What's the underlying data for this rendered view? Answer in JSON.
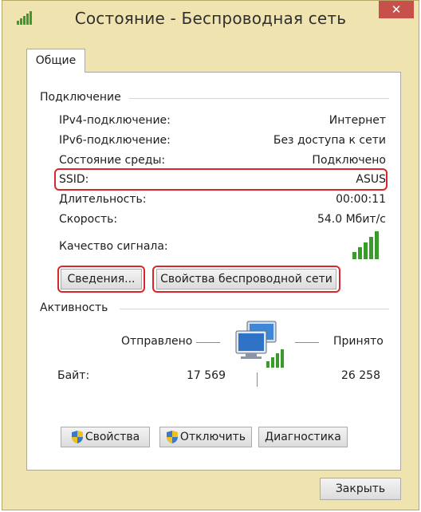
{
  "window": {
    "title": "Состояние - Беспроводная сеть",
    "close_label": "✕"
  },
  "tabs": [
    {
      "label": "Общие",
      "active": true
    }
  ],
  "connection": {
    "group_title": "Подключение",
    "rows": [
      {
        "label": "IPv4-подключение:",
        "value": "Интернет"
      },
      {
        "label": "IPv6-подключение:",
        "value": "Без доступа к сети"
      },
      {
        "label": "Состояние среды:",
        "value": "Подключено"
      },
      {
        "label": "SSID:",
        "value": "ASUS"
      },
      {
        "label": "Длительность:",
        "value": "00:00:11"
      },
      {
        "label": "Скорость:",
        "value": "54.0 Мбит/с"
      }
    ],
    "signal_label": "Качество сигнала:",
    "signal_bars": 5,
    "details_button": "Сведения...",
    "wireless_props_button": "Свойства беспроводной сети"
  },
  "activity": {
    "group_title": "Активность",
    "sent_label": "Отправлено",
    "received_label": "Принято",
    "bytes_label": "Байт:",
    "bytes_sent": "17 569",
    "bytes_received": "26 258"
  },
  "actions": {
    "properties": "Свойства",
    "disable": "Отключить",
    "diagnostics": "Диагностика"
  },
  "close_button": "Закрыть",
  "colors": {
    "highlight": "#d9262b",
    "signal_green": "#3a9a2c",
    "titlebar": "#efe4b0"
  }
}
